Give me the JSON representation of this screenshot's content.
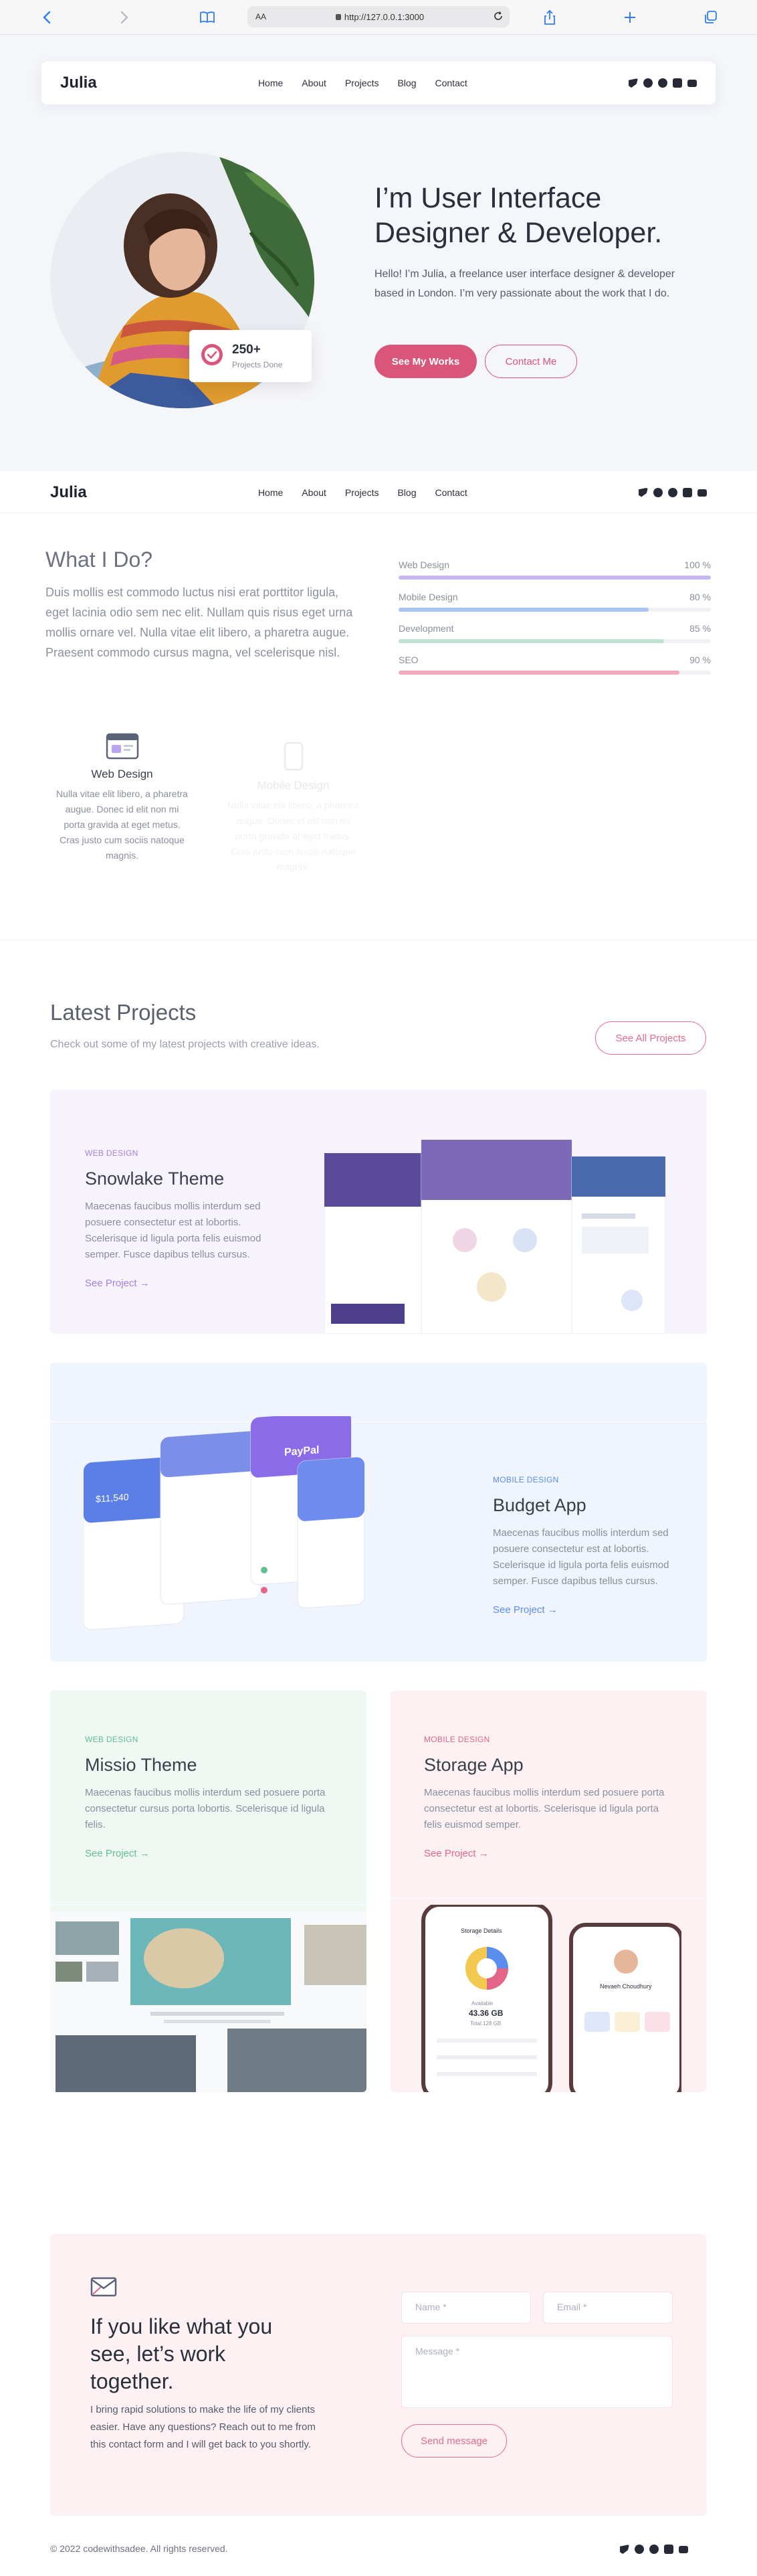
{
  "browser": {
    "text_size_label": "AA",
    "url": "http://127.0.0.1:3000"
  },
  "brand": {
    "logo": "Julia"
  },
  "nav": {
    "items": [
      "Home",
      "About",
      "Projects",
      "Blog",
      "Contact"
    ],
    "social_icons": [
      "twitter-icon",
      "facebook-icon",
      "dribbble-icon",
      "instagram-icon",
      "youtube-icon"
    ]
  },
  "hero": {
    "title": "I’m User Interface Designer & Developer.",
    "text": "Hello! I’m Julia, a freelance user interface designer & developer based in London. I’m very passionate about the work that I do.",
    "primary_button": "See My Works",
    "secondary_button": "Contact Me",
    "stat_value": "250+",
    "stat_label": "Projects Done"
  },
  "what_i_do": {
    "title": "What I Do?",
    "text": "Duis mollis est commodo luctus nisi erat porttitor ligula, eget lacinia odio sem nec elit. Nullam quis risus eget urna mollis ornare vel. Nulla vitae elit libero, a pharetra augue. Praesent commodo cursus magna, vel scelerisque nisl.",
    "skills": [
      {
        "name": "Web Design",
        "percent_label": "100 %",
        "value": 100,
        "color": "#c7b7f0"
      },
      {
        "name": "Mobile Design",
        "percent_label": "80 %",
        "value": 80,
        "color": "#a9c4f2"
      },
      {
        "name": "Development",
        "percent_label": "85 %",
        "value": 85,
        "color": "#bfe3d2"
      },
      {
        "name": "SEO",
        "percent_label": "90 %",
        "value": 90,
        "color": "#f4a9bf"
      }
    ],
    "services": [
      {
        "title": "Web Design",
        "text": "Nulla vitae elit libero, a pharetra augue. Donec id elit non mi porta gravida at eget metus. Cras justo cum sociis natoque magnis."
      },
      {
        "title": "Mobile Design",
        "text": "Nulla vitae elit libero, a pharetra augue. Donec id elit non mi porta gravida at eget metus. Cras justo cum sociis natoque magnis."
      }
    ]
  },
  "projects": {
    "title": "Latest Projects",
    "subtitle": "Check out some of my latest projects with creative ideas.",
    "see_all": "See All Projects",
    "items": [
      {
        "tag": "WEB DESIGN",
        "name": "Snowlake Theme",
        "desc": "Maecenas faucibus mollis interdum sed posuere consectetur est at lobortis. Scelerisque id ligula porta felis euismod semper. Fusce dapibus tellus cursus.",
        "link": "See Project",
        "accent": "#a77fe0",
        "bg": "#f6f3fd"
      },
      {
        "tag": "MOBILE DESIGN",
        "name": "Budget App",
        "desc": "Maecenas faucibus mollis interdum sed posuere consectetur est at lobortis. Scelerisque id ligula porta felis euismod semper. Fusce dapibus tellus cursus.",
        "link": "See Project",
        "accent": "#5b8def",
        "bg": "#eff4fd"
      },
      {
        "tag": "WEB DESIGN",
        "name": "Missio Theme",
        "desc": "Maecenas faucibus mollis interdum sed posuere porta consectetur cursus porta lobortis. Scelerisque id ligula felis.",
        "link": "See Project",
        "accent": "#62bf90",
        "bg": "#f0f8f4"
      },
      {
        "tag": "MOBILE DESIGN",
        "name": "Storage App",
        "desc": "Maecenas faucibus mollis interdum sed posuere porta consectetur est at lobortis. Scelerisque id ligula porta felis euismod semper.",
        "link": "See Project",
        "accent": "#e3668a",
        "bg": "#fdf1f4"
      }
    ],
    "mockup_text": {
      "budget_balance": "$11,540",
      "paypal": "PayPal",
      "storage_title": "Storage Details",
      "storage_value": "43.36 GB",
      "storage_available": "Available",
      "storage_total": "Total 128 GB",
      "profile_name": "Nevaeh Choudhury"
    }
  },
  "contact": {
    "title": "If you like what you see, let’s work together.",
    "text": "I bring rapid solutions to make the life of my clients easier. Have any questions? Reach out to me from this contact form and I will get back to you shortly.",
    "name_placeholder": "Name *",
    "email_placeholder": "Email *",
    "message_placeholder": "Message *",
    "send_button": "Send message"
  },
  "footer": {
    "copyright": "© 2022 codewithsadee. All rights reserved."
  }
}
